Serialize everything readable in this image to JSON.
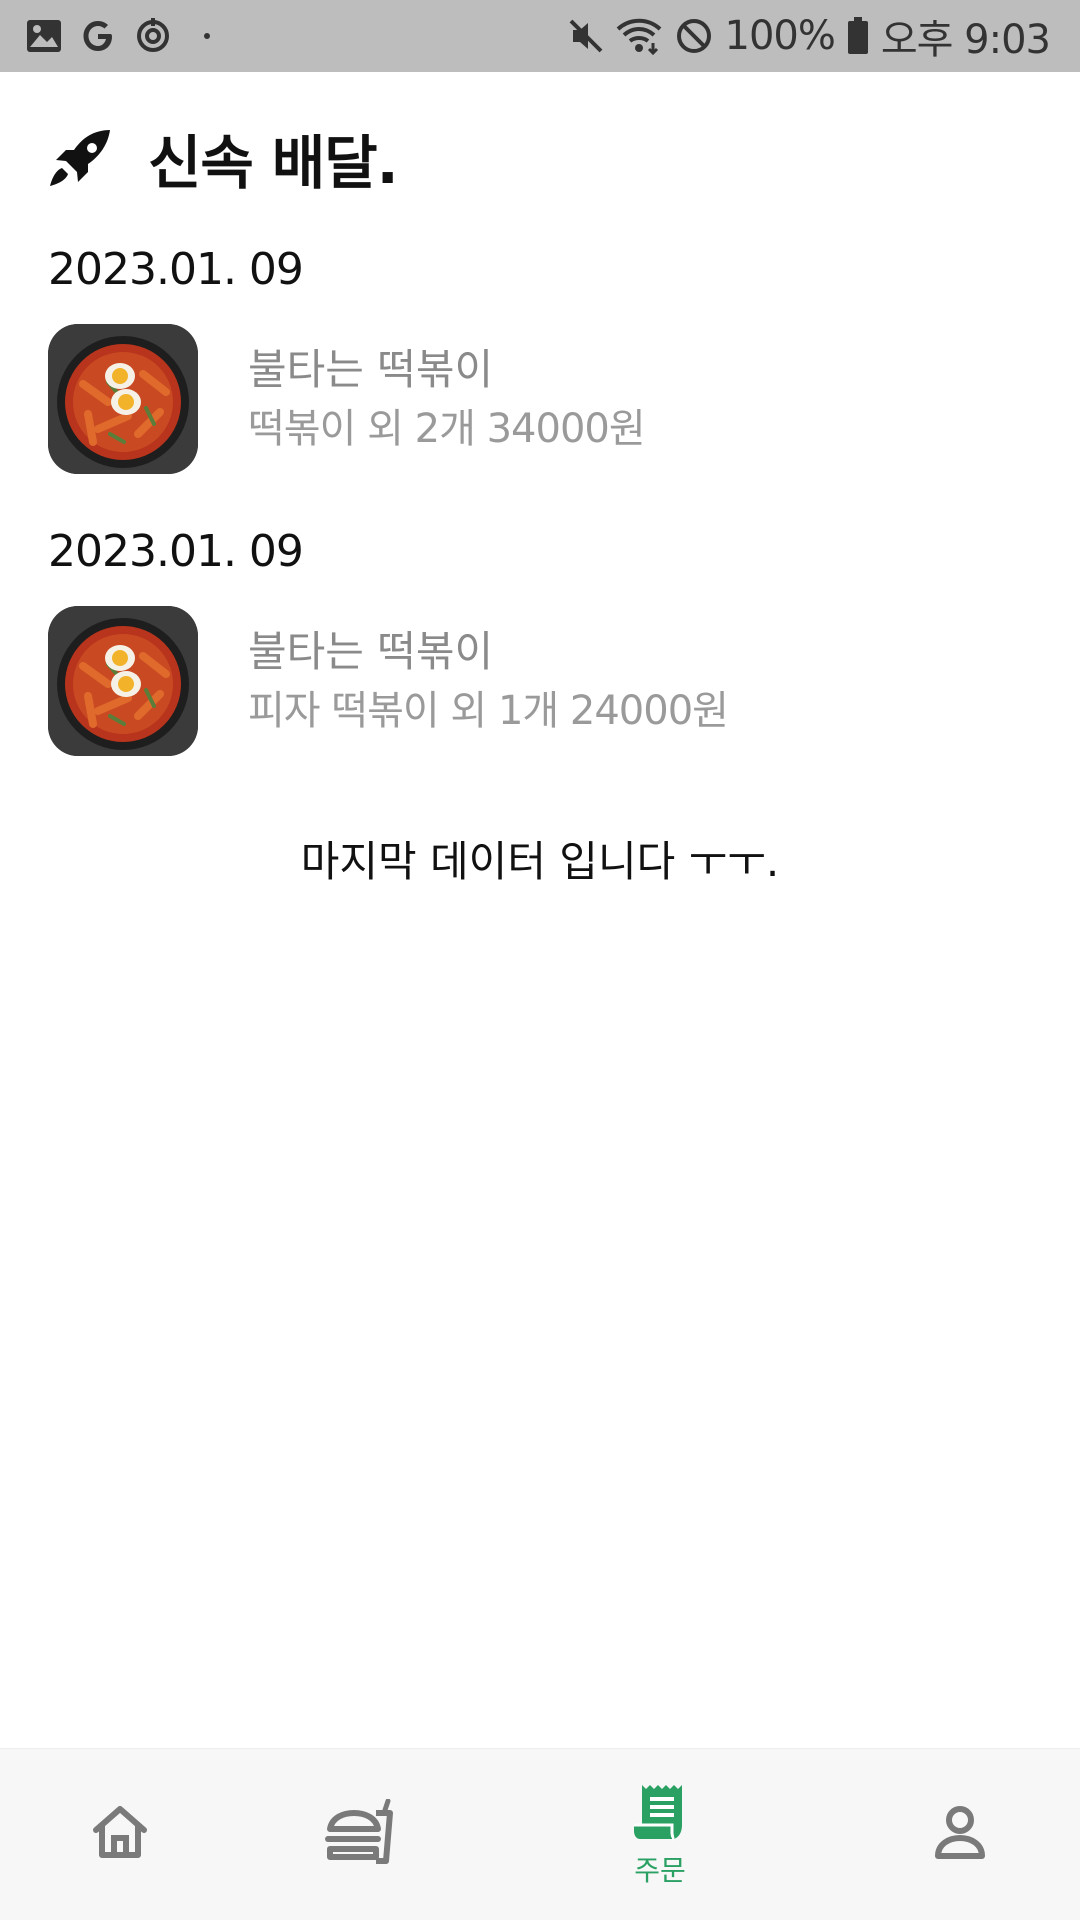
{
  "status_bar": {
    "battery": "100%",
    "time": "오후 9:03",
    "icons": [
      "gallery-icon",
      "google-icon",
      "sync-icon",
      "mute-icon",
      "wifi-icon",
      "no-disturb-icon",
      "battery-icon"
    ]
  },
  "header": {
    "title": "신속 배달.",
    "icon": "rocket-icon"
  },
  "orders": [
    {
      "date": "2023.01. 09",
      "shop": "불타는 떡볶이",
      "summary": "떡볶이 외 2개 34000원"
    },
    {
      "date": "2023.01. 09",
      "shop": "불타는 떡볶이",
      "summary": "피자 떡볶이 외 1개 24000원"
    }
  ],
  "end_message": "마지막 데이터 입니다 ㅜㅜ.",
  "bottom_nav": {
    "items": [
      {
        "icon": "home-icon",
        "label": ""
      },
      {
        "icon": "food-icon",
        "label": ""
      },
      {
        "icon": "receipt-icon",
        "label": "주문",
        "active": true
      },
      {
        "icon": "profile-icon",
        "label": ""
      }
    ],
    "active_color": "#2aa163",
    "inactive_color": "#7a7a7a"
  }
}
